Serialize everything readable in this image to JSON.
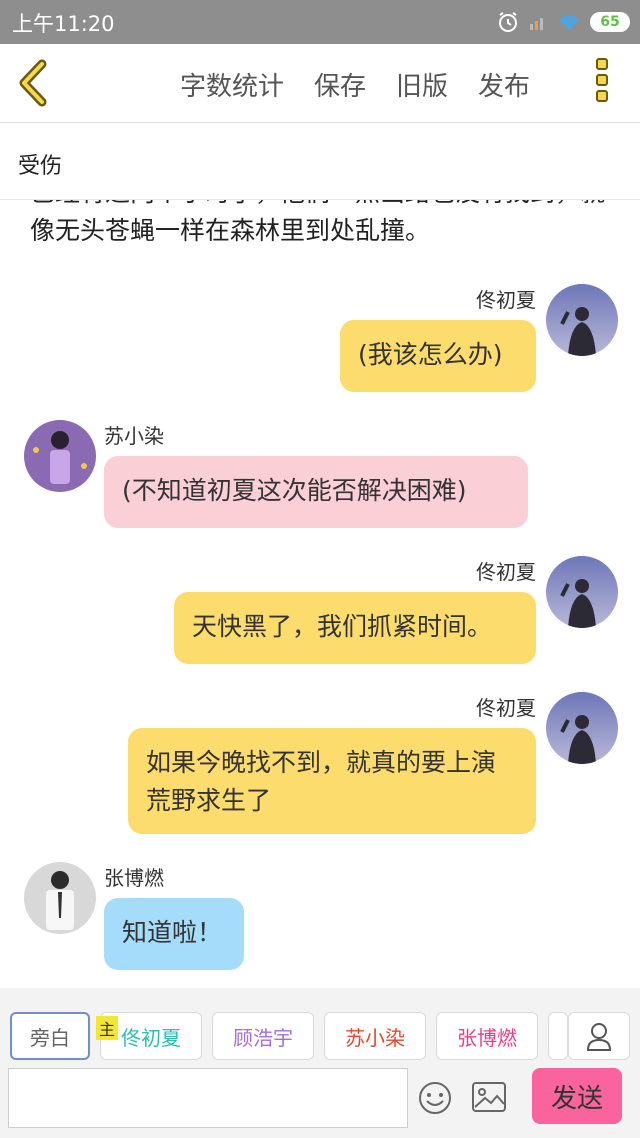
{
  "status_bar": {
    "time": "上午11:20",
    "battery": "65"
  },
  "toolbar": {
    "word_count": "字数统计",
    "save": "保存",
    "old_version": "旧版",
    "publish": "发布"
  },
  "chapter": {
    "title": "受伤"
  },
  "narration": "已经将近两个小时了，他们一点出路也没有找到，就像无头苍蝇一样在森林里到处乱撞。",
  "messages": [
    {
      "sender": "佟初夏",
      "text": "(我该怎么办)",
      "side": "right",
      "color": "#fcdc6c"
    },
    {
      "sender": "苏小染",
      "text": "(不知道初夏这次能否解决困难)",
      "side": "left",
      "color": "#fbcfd6"
    },
    {
      "sender": "佟初夏",
      "text": "天快黑了，我们抓紧时间。",
      "side": "right",
      "color": "#fcdc6c"
    },
    {
      "sender": "佟初夏",
      "text": "如果今晚找不到，就真的要上演荒野求生了",
      "side": "right",
      "color": "#fcdc6c"
    },
    {
      "sender": "张博燃",
      "text": "知道啦！",
      "side": "left",
      "color": "#a4dcfa"
    }
  ],
  "roles": [
    {
      "label": "旁白",
      "color": "#666666"
    },
    {
      "label": "佟初夏",
      "color": "#2dbfae",
      "main": true
    },
    {
      "label": "顾浩宇",
      "color": "#a46fd6"
    },
    {
      "label": "苏小染",
      "color": "#e04a2a"
    },
    {
      "label": "张博燃",
      "color": "#ea3f87"
    }
  ],
  "main_tag": "主",
  "input": {
    "placeholder": ""
  },
  "send_label": "发送",
  "icons": {
    "back": "chevron-left-icon",
    "more": "more-squares-icon",
    "person": "person-icon",
    "emoji": "smiley-icon",
    "image": "image-icon"
  }
}
